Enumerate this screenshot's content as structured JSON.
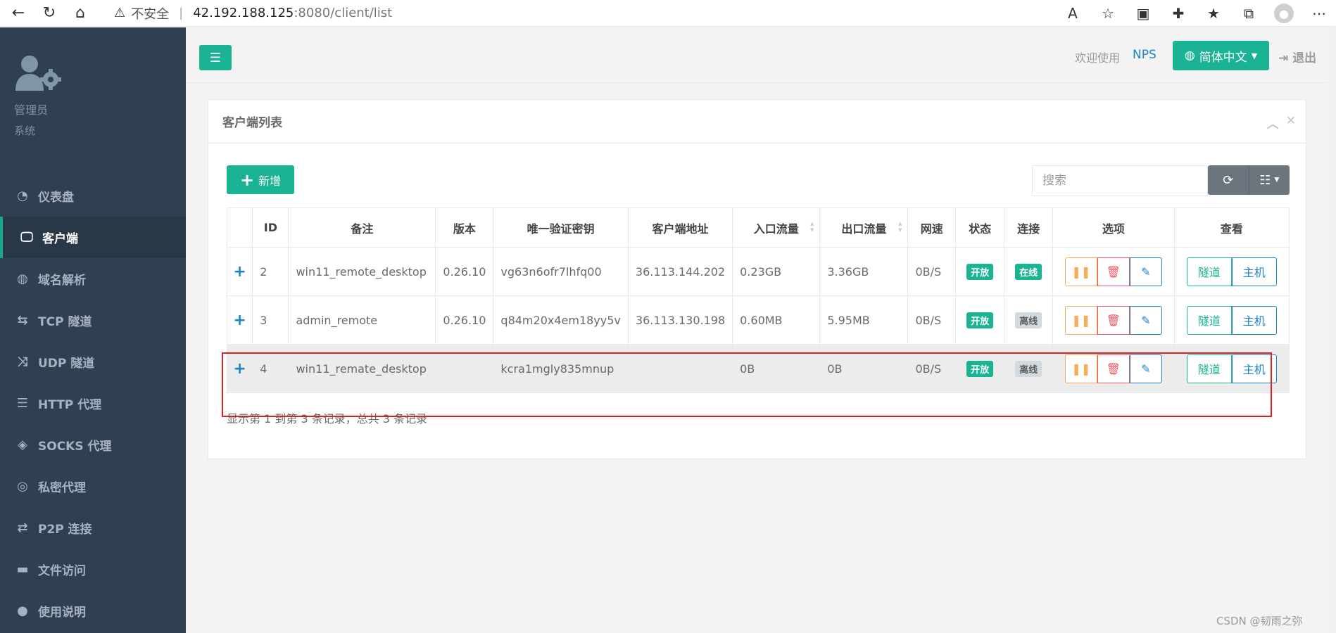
{
  "browser": {
    "insecure_label": "不安全",
    "separator": "|",
    "url_host": "42.192.188.125",
    "url_path": ":8080/client/list"
  },
  "sidebar": {
    "role": "管理员",
    "sub": "系统",
    "items": [
      {
        "label": "仪表盘",
        "icon": "dashboard-icon"
      },
      {
        "label": "客户端",
        "icon": "desktop-icon",
        "active": true
      },
      {
        "label": "域名解析",
        "icon": "globe-icon"
      },
      {
        "label": "TCP 隧道",
        "icon": "retweet-icon"
      },
      {
        "label": "UDP 隧道",
        "icon": "random-icon"
      },
      {
        "label": "HTTP 代理",
        "icon": "server-icon"
      },
      {
        "label": "SOCKS 代理",
        "icon": "layers-icon"
      },
      {
        "label": "私密代理",
        "icon": "eye-slash-icon"
      },
      {
        "label": "P2P 连接",
        "icon": "exchange-icon"
      },
      {
        "label": "文件访问",
        "icon": "briefcase-icon"
      },
      {
        "label": "使用说明",
        "icon": "lightbulb-icon"
      }
    ]
  },
  "header": {
    "welcome": "欢迎使用",
    "brand": "NPS",
    "language": "简体中文",
    "logout": "退出"
  },
  "panel": {
    "title": "客户端列表",
    "add_label": "新增",
    "search_placeholder": "搜索",
    "records_text": "显示第 1 到第 3 条记录，总共 3 条记录"
  },
  "table": {
    "headers": [
      "",
      "ID",
      "备注",
      "版本",
      "唯一验证密钥",
      "客户端地址",
      "入口流量",
      "出口流量",
      "网速",
      "状态",
      "连接",
      "选项",
      "查看"
    ],
    "rows": [
      {
        "expand": "+",
        "id": "2",
        "remark": "win11_remote_desktop",
        "version": "0.26.10",
        "vkey": "vg63n6ofr7lhfq00",
        "addr": "36.113.144.202",
        "in": "0.23GB",
        "out": "3.36GB",
        "speed": "0B/S",
        "status": "开放",
        "conn": "在线",
        "conn_online": true
      },
      {
        "expand": "+",
        "id": "3",
        "remark": "admin_remote",
        "version": "0.26.10",
        "vkey": "q84m20x4em18yy5v",
        "addr": "36.113.130.198",
        "in": "0.60MB",
        "out": "5.95MB",
        "speed": "0B/S",
        "status": "开放",
        "conn": "离线",
        "conn_online": false
      },
      {
        "expand": "+",
        "id": "4",
        "remark": "win11_remate_desktop",
        "version": "",
        "vkey": "kcra1mgly835mnup",
        "addr": "",
        "in": "0B",
        "out": "0B",
        "speed": "0B/S",
        "status": "开放",
        "conn": "离线",
        "conn_online": false
      }
    ],
    "view_tunnel": "隧道",
    "view_host": "主机"
  },
  "watermark": "CSDN @韧雨之弥",
  "colors": {
    "primary": "#1ab394",
    "sidebar": "#2f4050",
    "info": "#1c84c6",
    "warning": "#f8ac59",
    "danger": "#ed5565",
    "highlight": "#e02020"
  }
}
